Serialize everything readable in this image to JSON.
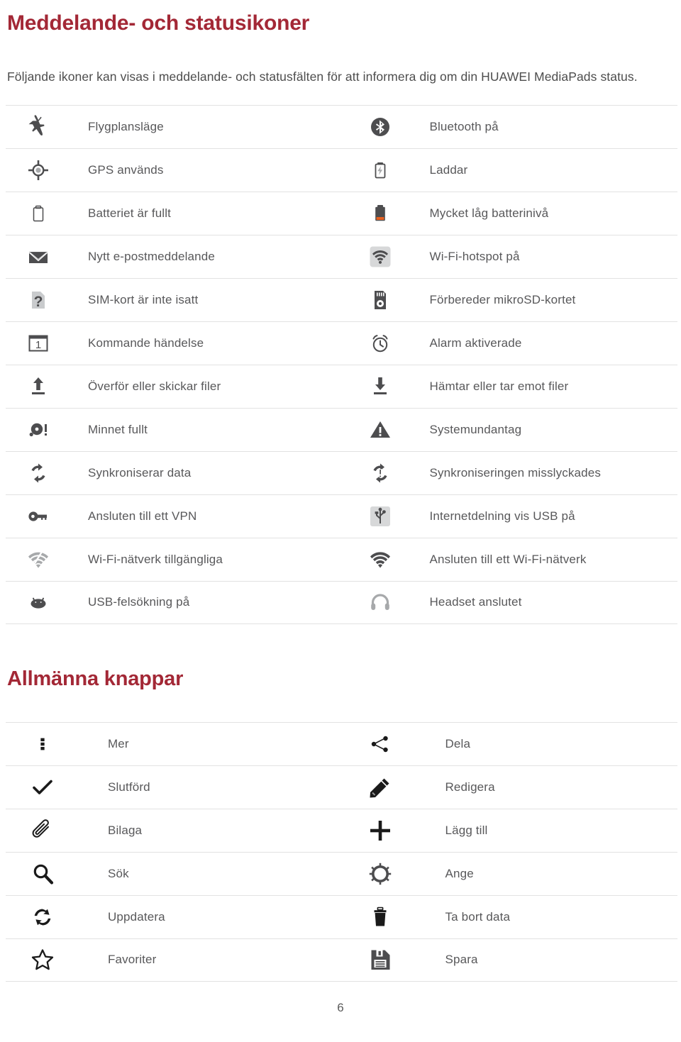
{
  "document": {
    "page_number": "6"
  },
  "section1": {
    "title": "Meddelande- och statusikoner",
    "intro": "Följande ikoner kan visas i meddelande- och statusfälten för att informera dig om din HUAWEI MediaPads status.",
    "rows": [
      {
        "left": {
          "icon": "airplane-icon",
          "label": "Flygplansläge"
        },
        "right": {
          "icon": "bluetooth-icon",
          "label": "Bluetooth på"
        }
      },
      {
        "left": {
          "icon": "gps-location-icon",
          "label": "GPS används"
        },
        "right": {
          "icon": "battery-charging-icon",
          "label": "Laddar"
        }
      },
      {
        "left": {
          "icon": "battery-full-icon",
          "label": "Batteriet är fullt"
        },
        "right": {
          "icon": "battery-low-icon",
          "label": "Mycket låg batterinivå"
        }
      },
      {
        "left": {
          "icon": "envelope-icon",
          "label": "Nytt e-postmeddelande"
        },
        "right": {
          "icon": "wifi-hotspot-icon",
          "label": "Wi-Fi-hotspot på"
        }
      },
      {
        "left": {
          "icon": "sim-card-question-icon",
          "label": "SIM-kort är inte isatt"
        },
        "right": {
          "icon": "microsd-card-icon",
          "label": "Förbereder mikroSD-kortet"
        }
      },
      {
        "left": {
          "icon": "calendar-event-icon",
          "label": "Kommande händelse"
        },
        "right": {
          "icon": "alarm-clock-icon",
          "label": "Alarm aktiverade"
        }
      },
      {
        "left": {
          "icon": "upload-arrow-icon",
          "label": "Överför eller skickar filer"
        },
        "right": {
          "icon": "download-arrow-icon",
          "label": "Hämtar eller tar emot filer"
        }
      },
      {
        "left": {
          "icon": "storage-full-icon",
          "label": "Minnet fullt"
        },
        "right": {
          "icon": "warning-triangle-icon",
          "label": "Systemundantag"
        }
      },
      {
        "left": {
          "icon": "sync-icon",
          "label": "Synkroniserar data"
        },
        "right": {
          "icon": "sync-error-icon",
          "label": "Synkroniseringen misslyckades"
        }
      },
      {
        "left": {
          "icon": "vpn-key-icon",
          "label": "Ansluten till ett VPN"
        },
        "right": {
          "icon": "usb-tethering-icon",
          "label": "Internetdelning vis USB på"
        }
      },
      {
        "left": {
          "icon": "wifi-available-icon",
          "label": "Wi-Fi-nätverk tillgängliga"
        },
        "right": {
          "icon": "wifi-connected-icon",
          "label": "Ansluten till ett Wi-Fi-nätverk"
        }
      },
      {
        "left": {
          "icon": "android-debug-icon",
          "label": "USB-felsökning på"
        },
        "right": {
          "icon": "headset-icon",
          "label": "Headset anslutet"
        }
      }
    ]
  },
  "section2": {
    "title": "Allmänna knappar",
    "rows": [
      {
        "left": {
          "icon": "more-vertical-icon",
          "label": "Mer"
        },
        "right": {
          "icon": "share-icon",
          "label": "Dela"
        }
      },
      {
        "left": {
          "icon": "checkmark-icon",
          "label": "Slutförd"
        },
        "right": {
          "icon": "pencil-edit-icon",
          "label": "Redigera"
        }
      },
      {
        "left": {
          "icon": "paperclip-icon",
          "label": "Bilaga"
        },
        "right": {
          "icon": "plus-icon",
          "label": "Lägg till"
        }
      },
      {
        "left": {
          "icon": "search-icon",
          "label": "Sök"
        },
        "right": {
          "icon": "gear-icon",
          "label": "Ange"
        }
      },
      {
        "left": {
          "icon": "refresh-icon",
          "label": "Uppdatera"
        },
        "right": {
          "icon": "trash-icon",
          "label": "Ta bort data"
        }
      },
      {
        "left": {
          "icon": "star-outline-icon",
          "label": "Favoriter"
        },
        "right": {
          "icon": "save-disk-icon",
          "label": "Spara"
        }
      }
    ]
  },
  "colors": {
    "heading": "#a32836",
    "text": "#58585a",
    "rule": "#e2e2e2",
    "icon_dark": "#4d4d4f",
    "icon_black": "#1a1a1a",
    "battery_orange": "#e8601f",
    "icon_light": "#a7a9ab"
  }
}
